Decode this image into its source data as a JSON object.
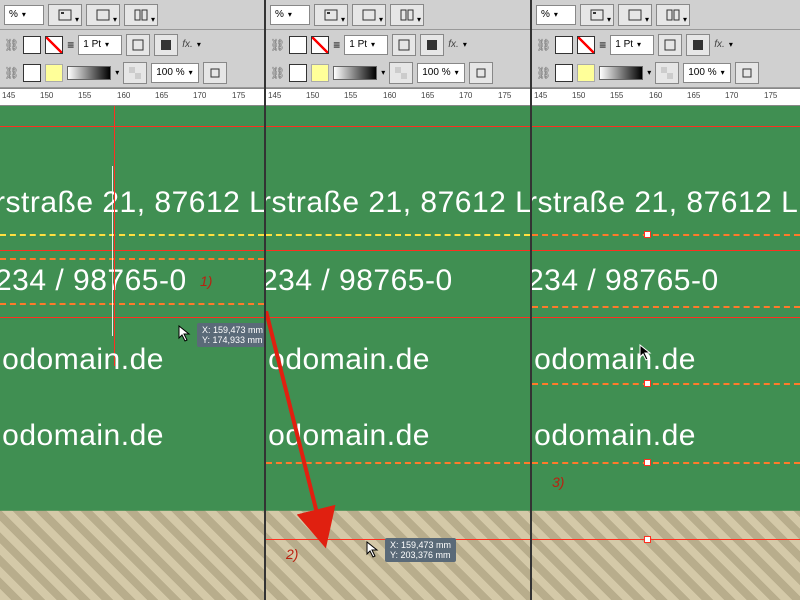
{
  "toolbar": {
    "percent_label": "%",
    "stroke_weight": "1 Pt",
    "opacity": "100 %",
    "fx": "fx."
  },
  "ruler": {
    "ticks": [
      145,
      150,
      155,
      160,
      165,
      170,
      175
    ]
  },
  "canvas": {
    "address": "rstraße 21, 87612 L",
    "phone": "234 / 98765-0",
    "domain1": "iodomain.de",
    "domain2": "iodomain.de"
  },
  "panel1": {
    "annotation": "1)",
    "tooltip_x": "X: 159,473 mm",
    "tooltip_y": "Y: 174,933 mm"
  },
  "panel2": {
    "annotation": "2)",
    "tooltip_x": "X: 159,473 mm",
    "tooltip_y": "Y: 203,376 mm"
  },
  "panel3": {
    "annotation": "3)"
  }
}
